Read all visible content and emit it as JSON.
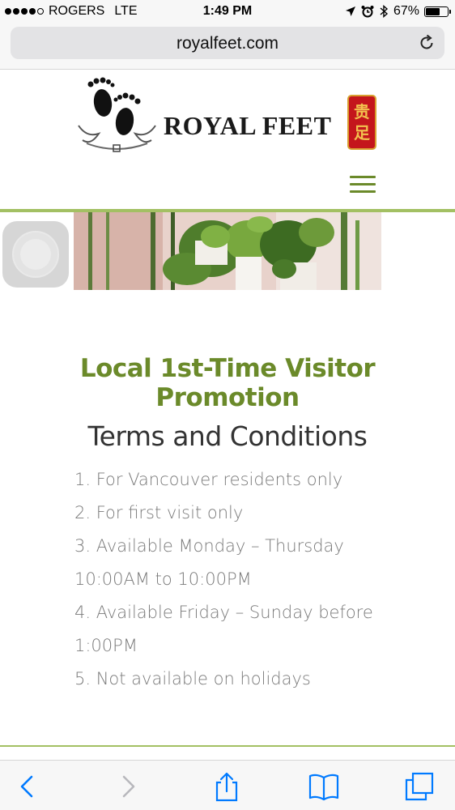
{
  "status_bar": {
    "carrier": "ROGERS",
    "network": "LTE",
    "time": "1:49 PM",
    "battery_percent": "67%",
    "battery_level": 0.67
  },
  "browser": {
    "url": "royalfeet.com"
  },
  "site": {
    "logo_text": "ROYAL FEET",
    "logo_chinese": [
      "贵",
      "足"
    ]
  },
  "content": {
    "promo_title": "Local 1st-Time Visitor Promotion",
    "terms_heading": "Terms and Conditions",
    "terms": [
      "1. For Vancouver residents only",
      "2. For first visit only",
      "3. Available Monday – Thursday",
      "10:00AM to 10:00PM",
      "4. Available Friday – Sunday before",
      "1:00PM",
      "5. Not available on holidays"
    ]
  },
  "colors": {
    "accent_green": "#6b8a2a",
    "rule_green": "#a3c063",
    "ios_blue": "#007aff"
  },
  "icons": [
    "location-arrow-icon",
    "alarm-icon",
    "bluetooth-icon",
    "battery-icon",
    "reload-icon",
    "hamburger-menu-icon",
    "back-icon",
    "forward-icon",
    "share-icon",
    "bookmarks-icon",
    "tabs-icon"
  ]
}
